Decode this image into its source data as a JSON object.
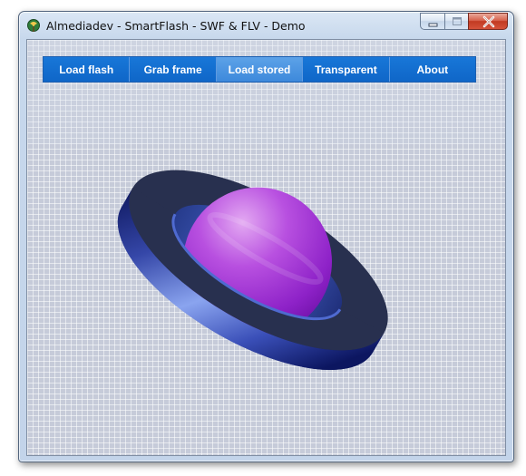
{
  "window": {
    "title": "Almediadev - SmartFlash - SWF & FLV - Demo"
  },
  "caption_buttons": {
    "minimize": "minimize-icon",
    "maximize": "maximize-icon",
    "close": "close-icon"
  },
  "menu": {
    "items": [
      {
        "label": "Load flash"
      },
      {
        "label": "Grab frame"
      },
      {
        "label": "Load stored"
      },
      {
        "label": "Transparent"
      },
      {
        "label": "About"
      }
    ],
    "active_index": 2
  },
  "colors": {
    "menu_blue": "#0f66c8",
    "menu_active": "#4590de",
    "planet_purple": "#a133d8",
    "ring_navy": "#1d2a6e",
    "ring_top": "#2b3150"
  },
  "icons": {
    "app": "globe-tree-icon",
    "artwork": "planet-with-ring-graphic"
  }
}
